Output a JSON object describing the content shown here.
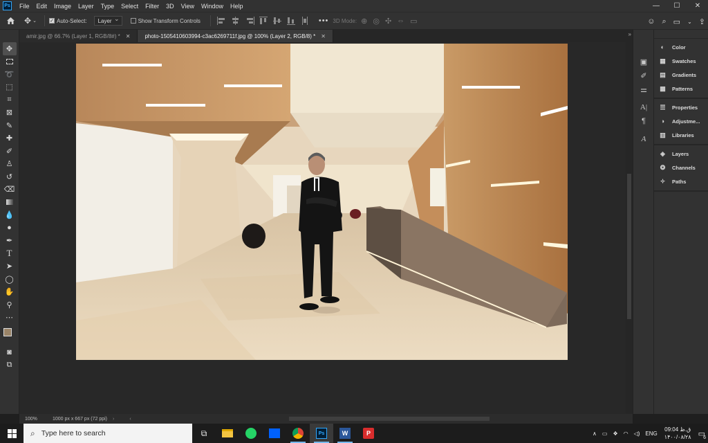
{
  "app": {
    "logo": "Ps"
  },
  "menu": [
    "File",
    "Edit",
    "Image",
    "Layer",
    "Type",
    "Select",
    "Filter",
    "3D",
    "View",
    "Window",
    "Help"
  ],
  "window_controls": {
    "minimize": "—",
    "maximize": "☐",
    "close": "✕"
  },
  "options": {
    "auto_select_label": "Auto-Select:",
    "auto_select_checked": true,
    "auto_select_target": "Layer",
    "show_transform_label": "Show Transform Controls",
    "show_transform_checked": false,
    "more": "•••",
    "mode_3d": "3D Mode:"
  },
  "tabs": [
    {
      "title": "amir.jpg @ 66.7% (Layer 1, RGB/8#) *",
      "active": false
    },
    {
      "title": "photo-1505410603994-c3ac6269711f.jpg @ 100% (Layer 2, RGB/8) *",
      "active": true
    }
  ],
  "statusbar": {
    "zoom": "100%",
    "info": "1000 px x 667 px (72 ppi)"
  },
  "colors": {
    "foreground": "#9a8468",
    "background": "#ffffff",
    "accent": "#31a8ff"
  },
  "panels": [
    {
      "icon": "color-icon",
      "label": "Color"
    },
    {
      "icon": "swatches-icon",
      "label": "Swatches"
    },
    {
      "icon": "gradients-icon",
      "label": "Gradients"
    },
    {
      "icon": "patterns-icon",
      "label": "Patterns"
    },
    {
      "icon": "properties-icon",
      "label": "Properties"
    },
    {
      "icon": "adjustments-icon",
      "label": "Adjustme..."
    },
    {
      "icon": "libraries-icon",
      "label": "Libraries"
    },
    {
      "icon": "layers-icon",
      "label": "Layers"
    },
    {
      "icon": "channels-icon",
      "label": "Channels"
    },
    {
      "icon": "paths-icon",
      "label": "Paths"
    }
  ],
  "taskbar": {
    "search_placeholder": "Type here to search",
    "language": "ENG",
    "time": "09:04 ق.ظ",
    "date": "۱۴۰۰/۰۸/۲۸",
    "notifications": "6"
  }
}
